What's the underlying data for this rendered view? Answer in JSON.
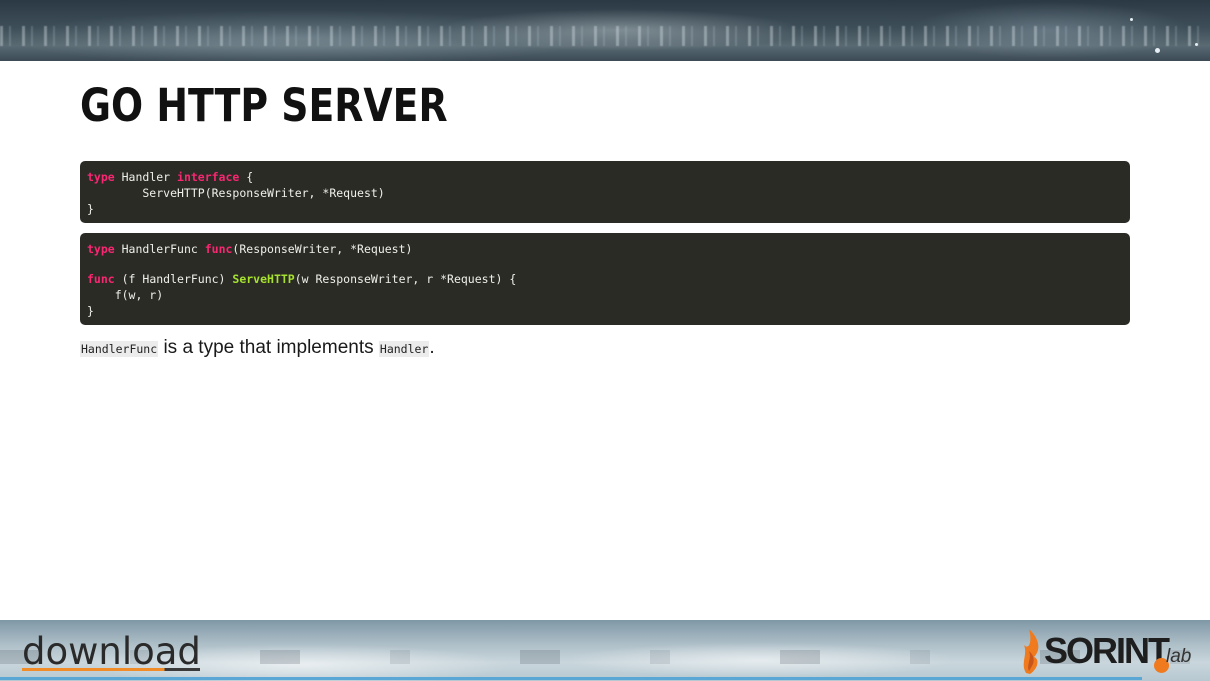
{
  "slide": {
    "title": "Go HTTP server"
  },
  "code_block_1": {
    "lines": [
      [
        {
          "text": "type",
          "style": "kw"
        },
        {
          "text": " Handler ",
          "style": "plain"
        },
        {
          "text": "interface",
          "style": "kw"
        },
        {
          "text": " {",
          "style": "plain"
        }
      ],
      [
        {
          "text": "        ServeHTTP(ResponseWriter, *Request)",
          "style": "plain"
        }
      ],
      [
        {
          "text": "}",
          "style": "plain"
        }
      ]
    ]
  },
  "code_block_2": {
    "lines": [
      [
        {
          "text": "type",
          "style": "kw"
        },
        {
          "text": " HandlerFunc ",
          "style": "plain"
        },
        {
          "text": "func",
          "style": "kw"
        },
        {
          "text": "(ResponseWriter, *Request)",
          "style": "plain"
        }
      ],
      [],
      [
        {
          "text": "func",
          "style": "kw"
        },
        {
          "text": " (f HandlerFunc) ",
          "style": "plain"
        },
        {
          "text": "ServeHTTP",
          "style": "fn"
        },
        {
          "text": "(w ResponseWriter, r *Request) {",
          "style": "plain"
        }
      ],
      [
        {
          "text": "    f(w, r)",
          "style": "plain"
        }
      ],
      [
        {
          "text": "}",
          "style": "plain"
        }
      ]
    ]
  },
  "description": {
    "code_1": "HandlerFunc",
    "text_1": " is a type that implements ",
    "code_2": "Handler",
    "text_2": "."
  },
  "footer": {
    "left_logo_text": "download",
    "right_logo_text": "SORINT",
    "right_logo_suffix": "lab"
  },
  "colors": {
    "keyword": "#f92672",
    "function_name": "#a6e22e",
    "code_background": "#2b2b26",
    "accent_orange": "#f07a1e",
    "footer_line": "#5aa7d6"
  }
}
